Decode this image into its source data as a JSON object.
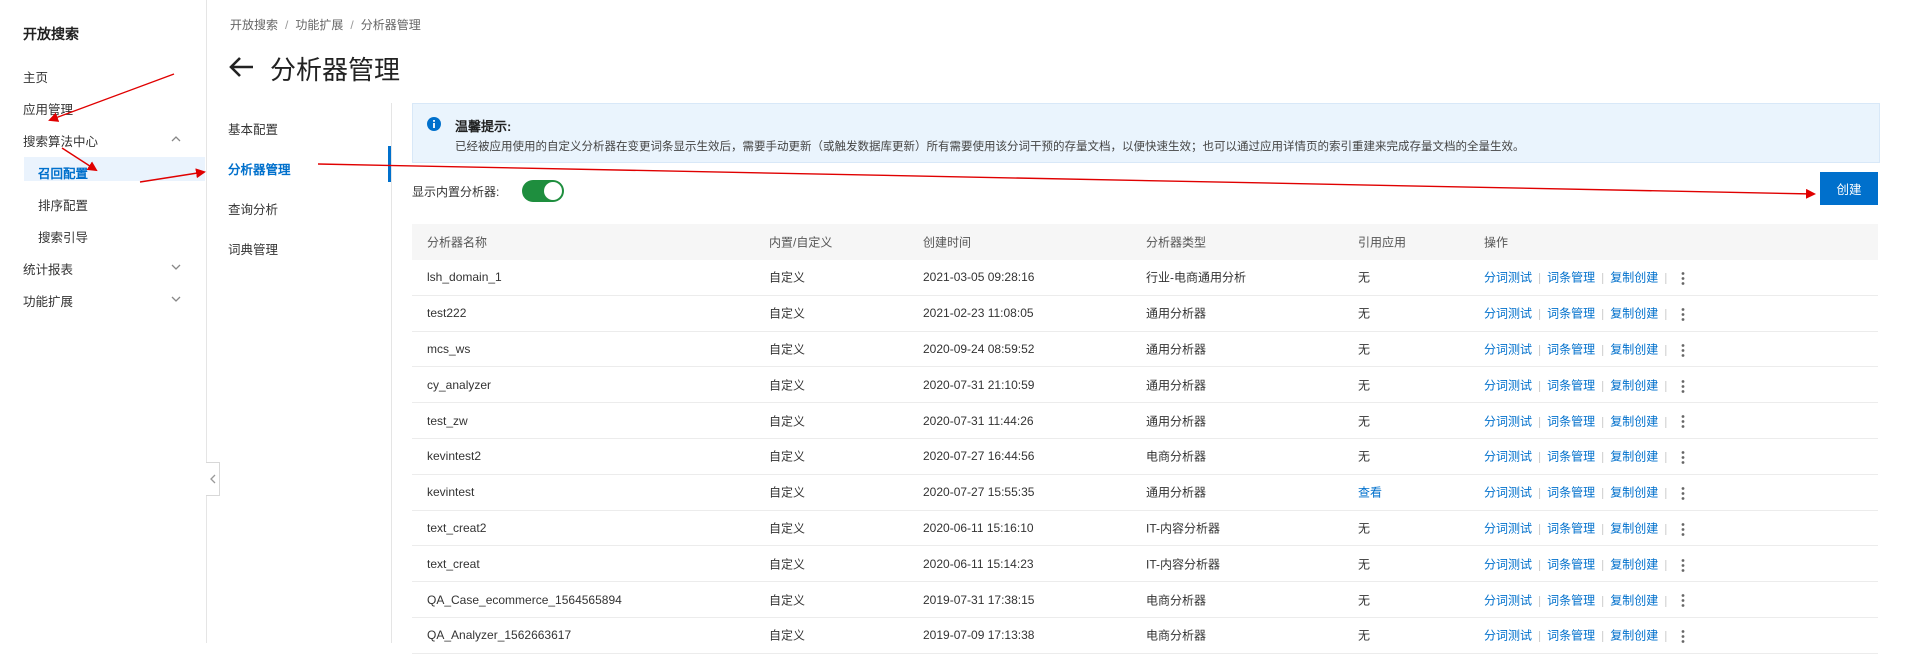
{
  "sidebar": {
    "title": "开放搜索",
    "items": [
      {
        "label": "主页"
      },
      {
        "label": "应用管理"
      },
      {
        "label": "搜索算法中心"
      },
      {
        "label": "召回配置"
      },
      {
        "label": "排序配置"
      },
      {
        "label": "搜索引导"
      },
      {
        "label": "统计报表"
      },
      {
        "label": "功能扩展"
      }
    ]
  },
  "breadcrumb": {
    "items": [
      "开放搜索",
      "功能扩展",
      "分析器管理"
    ],
    "sep": "/"
  },
  "page": {
    "title": "分析器管理"
  },
  "subnav": {
    "items": [
      "基本配置",
      "分析器管理",
      "查询分析",
      "词典管理"
    ]
  },
  "notice": {
    "title": "温馨提示:",
    "text": "已经被应用使用的自定义分析器在变更词条显示生效后，需要手动更新（或触发数据库更新）所有需要使用该分词干预的存量文档，以便快速生效；也可以通过应用详情页的索引重建来完成存量文档的全量生效。"
  },
  "toolbar": {
    "toggle_label": "显示内置分析器:",
    "toggle_on": true,
    "create_label": "创建"
  },
  "table": {
    "headers": [
      "分析器名称",
      "内置/自定义",
      "创建时间",
      "分析器类型",
      "引用应用",
      "操作"
    ],
    "ops": [
      "分词测试",
      "词条管理",
      "复制创建"
    ],
    "rows": [
      {
        "name": "lsh_domain_1",
        "type": "自定义",
        "time": "2021-03-05 09:28:16",
        "kind": "行业-电商通用分析",
        "ref": "无"
      },
      {
        "name": "test222",
        "type": "自定义",
        "time": "2021-02-23 11:08:05",
        "kind": "通用分析器",
        "ref": "无"
      },
      {
        "name": "mcs_ws",
        "type": "自定义",
        "time": "2020-09-24 08:59:52",
        "kind": "通用分析器",
        "ref": "无"
      },
      {
        "name": "cy_analyzer",
        "type": "自定义",
        "time": "2020-07-31 21:10:59",
        "kind": "通用分析器",
        "ref": "无"
      },
      {
        "name": "test_zw",
        "type": "自定义",
        "time": "2020-07-31 11:44:26",
        "kind": "通用分析器",
        "ref": "无"
      },
      {
        "name": "kevintest2",
        "type": "自定义",
        "time": "2020-07-27 16:44:56",
        "kind": "电商分析器",
        "ref": "无"
      },
      {
        "name": "kevintest",
        "type": "自定义",
        "time": "2020-07-27 15:55:35",
        "kind": "通用分析器",
        "ref": "查看"
      },
      {
        "name": "text_creat2",
        "type": "自定义",
        "time": "2020-06-11 15:16:10",
        "kind": "IT-内容分析器",
        "ref": "无"
      },
      {
        "name": "text_creat",
        "type": "自定义",
        "time": "2020-06-11 15:14:23",
        "kind": "IT-内容分析器",
        "ref": "无"
      },
      {
        "name": "QA_Case_ecommerce_1564565894",
        "type": "自定义",
        "time": "2019-07-31 17:38:15",
        "kind": "电商分析器",
        "ref": "无"
      },
      {
        "name": "QA_Analyzer_1562663617",
        "type": "自定义",
        "time": "2019-07-09 17:13:38",
        "kind": "电商分析器",
        "ref": "无"
      }
    ]
  },
  "colors": {
    "accent": "#0070cc",
    "toggle": "#1e8e3e",
    "annotation": "#e00000"
  }
}
